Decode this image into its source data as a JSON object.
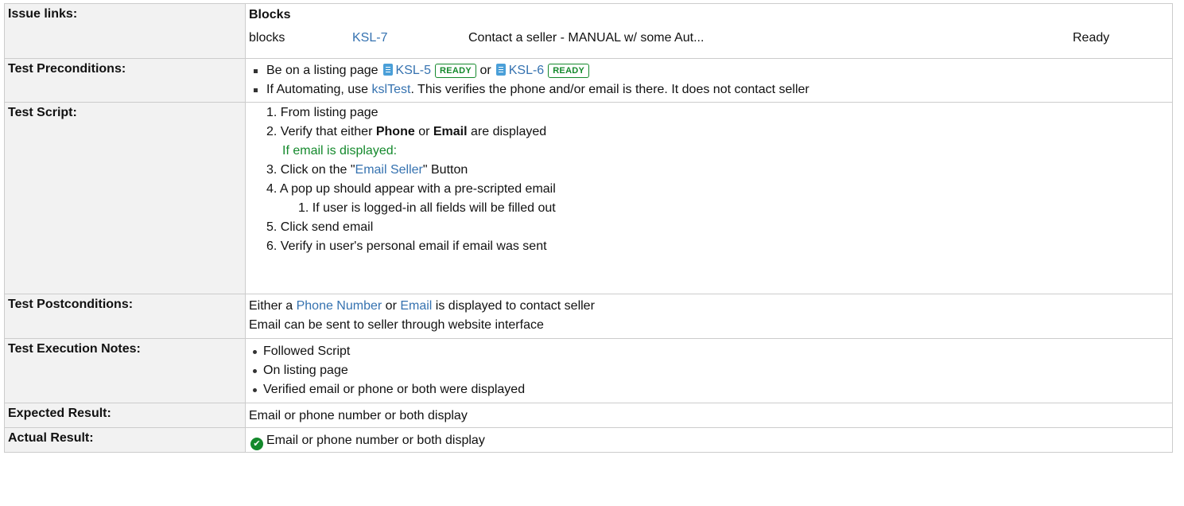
{
  "labels": {
    "issue_links": "Issue links:",
    "preconditions": "Test Preconditions:",
    "script": "Test Script:",
    "postconditions": "Test Postconditions:",
    "execution_notes": "Test Execution Notes:",
    "expected": "Expected Result:",
    "actual": "Actual Result:"
  },
  "issue_links": {
    "group_title": "Blocks",
    "row": {
      "relation": "blocks",
      "key": "KSL-7",
      "summary": "Contact a seller - MANUAL w/ some Aut...",
      "status": "Ready"
    }
  },
  "preconditions": {
    "line1": {
      "text_before": "Be on a listing page",
      "issue1_key": "KSL-5",
      "issue1_status": "READY",
      "or": "or",
      "issue2_key": "KSL-6",
      "issue2_status": "READY"
    },
    "line2": {
      "text_before": "If Automating, use",
      "link": "kslTest",
      "text_after": ". This verifies the phone and/or email is there. It does not contact seller"
    }
  },
  "script": {
    "s1": "1. From listing page",
    "s2_pre": "2. Verify that either ",
    "s2_phone": "Phone",
    "s2_or": " or ",
    "s2_email": "Email",
    "s2_post": " are displayed",
    "note": "If email is displayed:",
    "s3_pre": "3. Click on the \"",
    "s3_link": "Email Seller",
    "s3_post": "\" Button",
    "s4": "4. A pop up should appear with a pre-scripted email",
    "s4_1": "1. If user is logged-in all fields will be filled out",
    "s5": "5. Click send email",
    "s6": "6. Verify in user's personal email if email was sent"
  },
  "postconditions": {
    "l1_pre": "Either a ",
    "l1_phone": "Phone Number",
    "l1_or": " or ",
    "l1_email": "Email",
    "l1_post": " is displayed to contact seller",
    "l2": "Email can be sent to seller through website interface"
  },
  "execution_notes": [
    "Followed Script",
    "On listing page",
    "Verified email or phone or both were displayed"
  ],
  "expected": "Email or phone number or both display",
  "actual": "Email or phone number or both display",
  "colors": {
    "link": "#3572b0",
    "success": "#14892c",
    "label_bg": "#f2f2f2",
    "border": "#cccccc"
  }
}
